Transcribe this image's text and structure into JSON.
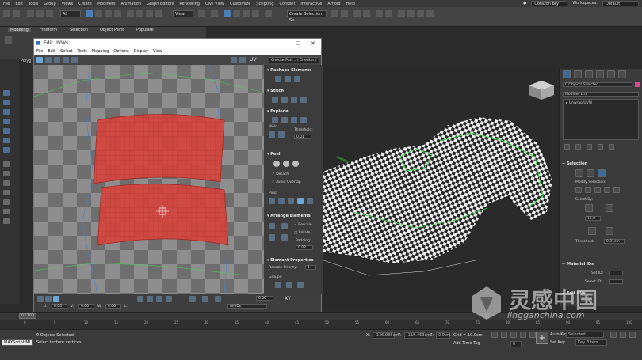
{
  "app": {
    "menu": [
      "File",
      "Edit",
      "Tools",
      "Group",
      "Views",
      "Create",
      "Modifiers",
      "Animation",
      "Graph Editors",
      "Rendering",
      "Civil View",
      "Customize",
      "Scripting",
      "Content",
      "Interactive",
      "Arnold",
      "Help"
    ],
    "user": "Corazon Bry",
    "workspace_label": "Workspaces:",
    "workspace": "Default",
    "toolbar_all": "All",
    "toolbar_view": "View",
    "selection_set": "Create Selection Se"
  },
  "ribbon": {
    "tabs": [
      "Modeling",
      "Freeform",
      "Selection",
      "Object Paint",
      "Populate"
    ],
    "active_tab": "Modeling",
    "poly_label": "Polyg"
  },
  "uvw": {
    "title": "Edit UVWs",
    "menu": [
      "File",
      "Edit",
      "Select",
      "Tools",
      "Mapping",
      "Options",
      "Display",
      "View"
    ],
    "uv_label": "UV",
    "checker_dropdown": "CheckerPatt... ( Checker )",
    "sections": {
      "reshape": "Reshape Elements",
      "stitch": "Stitch",
      "explode": "Explode",
      "weld": "Weld",
      "threshold_label": "Threshold:",
      "threshold": "0.01",
      "peel": "Peel",
      "detach": "Detach",
      "avoid_overlap": "Avoid Overlap",
      "pins": "Pins:",
      "arrange": "Arrange Elements",
      "rescale": "Rescale",
      "rotate": "Rotate",
      "padding_label": "Padding:",
      "padding": "0.02",
      "element_props": "Element Properties",
      "rescale_priority": "Rescale Priority:",
      "rescale_priority_val": "1",
      "groups": "Groups:"
    },
    "bottom": {
      "u_val": "0.00",
      "v_val": "0.00",
      "w_val": "0.00",
      "l_label": "L:",
      "zoom": "0.00",
      "xy": "XY",
      "all_ids": "All IDs"
    }
  },
  "cmdpanel": {
    "objects_selected": "0 Objects Selected",
    "modifier_list": "Modifier List",
    "stack_item": "Unwrap UVW",
    "selection_title": "Selection",
    "modify_selection": "Modify Selection:",
    "select_by": "Select By:",
    "angle": "15.0",
    "threshold_label": "Threshold:",
    "threshold": "0.01cm",
    "material_ids": "Material IDs",
    "set_id_label": "Set ID:",
    "select_id_label": "Select ID:",
    "edit_uvs": "Edit UVs"
  },
  "timeline": {
    "frame": "0 / 100",
    "ticks": [
      "0",
      "5",
      "10",
      "15",
      "20",
      "25",
      "30",
      "35",
      "40",
      "45",
      "50",
      "55",
      "60",
      "65",
      "70",
      "75",
      "80",
      "85",
      "90",
      "95",
      "100"
    ]
  },
  "status": {
    "maxscript": "MAXScript Mi",
    "objects_selected": "0 Objects Selected",
    "hint": "Select texture vertices",
    "x_label": "X:",
    "x_val": "-136.085cm",
    "y_label": "Y:",
    "y_val": "-115.463cm",
    "z_label": "Z:",
    "z_val": "0.0cm",
    "grid": "Grid = 10.0cm",
    "add_time_tag": "Add Time Tag",
    "auto_key": "Auto Key",
    "set_key": "Set Key",
    "selected": "Selected",
    "key_filters": "Key Filters...",
    "frame_field": "0"
  },
  "watermark": {
    "cn": "灵感中国",
    "url": "lingganchina.com"
  }
}
